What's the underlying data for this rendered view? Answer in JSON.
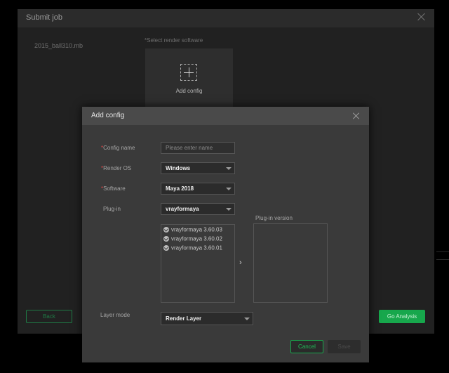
{
  "submit_job": {
    "title": "Submit job",
    "file_name": "2015_ball310.mb",
    "select_render_label": "*Select render software",
    "add_config_tile_label": "Add config",
    "back_label": "Back",
    "go_analysis_label": "Go Analysis"
  },
  "add_config": {
    "title": "Add config",
    "config_name": {
      "label": "Config name",
      "placeholder": "Please enter name",
      "value": ""
    },
    "render_os": {
      "label": "Render OS",
      "value": "Windows"
    },
    "software": {
      "label": "Software",
      "value": "Maya 2018"
    },
    "plugin": {
      "label": "Plug-in",
      "value": "vrayformaya"
    },
    "plugin_items": [
      {
        "label": "vrayformaya 3.60.03"
      },
      {
        "label": "vrayformaya 3.60.02"
      },
      {
        "label": "vrayformaya 3.60.01"
      }
    ],
    "plugin_version_label": "Plug-in version",
    "arrow": "›",
    "layer_mode": {
      "label": "Layer mode",
      "value": "Render Layer"
    },
    "required_mark": "*",
    "cancel_label": "Cancel",
    "save_label": "Save"
  },
  "colors": {
    "accent": "#17a74c",
    "required": "#e04848"
  }
}
